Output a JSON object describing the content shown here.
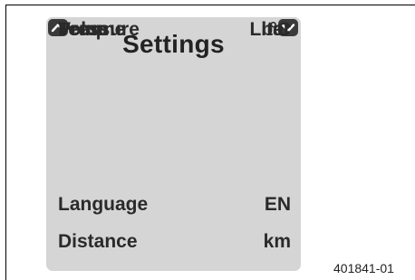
{
  "screen": {
    "title": "Settings",
    "settings": [
      {
        "label": "Language",
        "value": "EN"
      },
      {
        "label": "Distance",
        "value": "km"
      },
      {
        "label": "Temp",
        "value": "°C"
      },
      {
        "label": "Volume",
        "value": "Liter"
      },
      {
        "label": "Pressure",
        "value": "bar"
      }
    ],
    "nav": {
      "up_icon": "chevron-up-icon",
      "down_icon": "chevron-down-icon"
    }
  },
  "figure_id": "401841-01",
  "colors": {
    "panel_background": "#d5d5d5",
    "button_background": "#3a3a3a",
    "text": "#2a2a2a"
  }
}
